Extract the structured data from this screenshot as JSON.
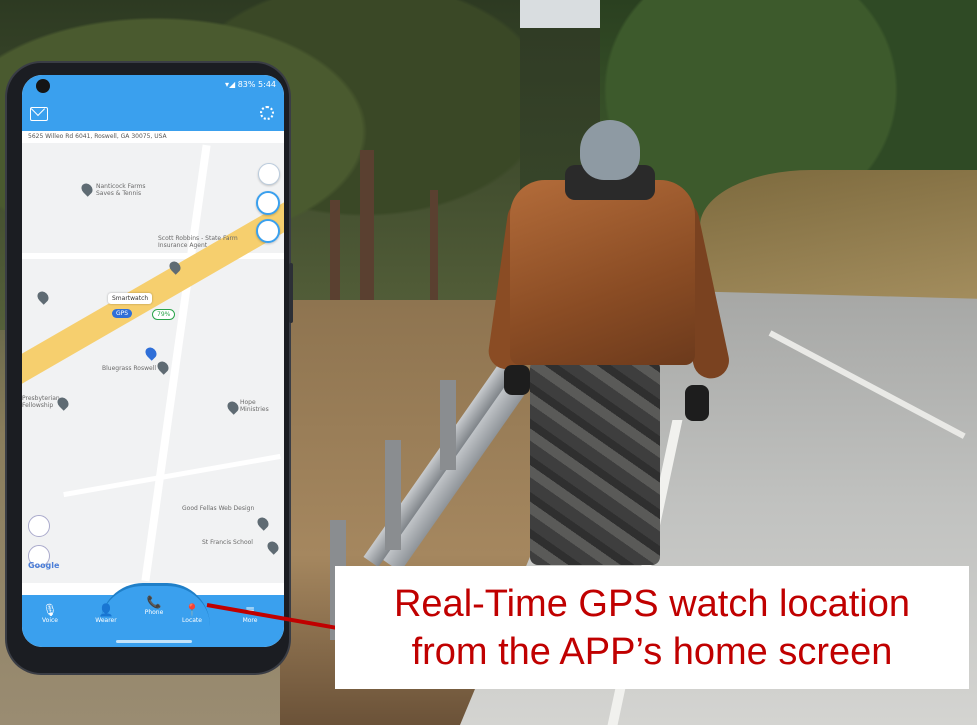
{
  "phone": {
    "status_text": "▾◢ 83% 5:44",
    "address": "5625 Willeo Rd 6041, Roswell, GA 30075, USA",
    "map": {
      "labels": [
        "Nanticock Farms Saves & Tennis",
        "Scott Robbins - State Farm Insurance Agent",
        "Smartwatch",
        "Bluegrass Roswell",
        "Hope Ministries",
        "Presbyterian Fellowship",
        "Good Fellas Web Design",
        "St Francis School"
      ],
      "watch_label": "Smartwatch",
      "gps_chip": "GPS",
      "battery_chip": "79%",
      "google": "Google"
    },
    "nav": [
      {
        "label": "Voice",
        "glyph": "🎙"
      },
      {
        "label": "Wearer",
        "glyph": "👤"
      },
      {
        "label": "Phone",
        "glyph": "📞"
      },
      {
        "label": "Locate",
        "glyph": "📍"
      },
      {
        "label": "More",
        "glyph": "≡"
      }
    ]
  },
  "callout": {
    "line1": "Real-Time GPS watch location",
    "line2": "from the APP’s home screen",
    "color": "#c00000"
  }
}
